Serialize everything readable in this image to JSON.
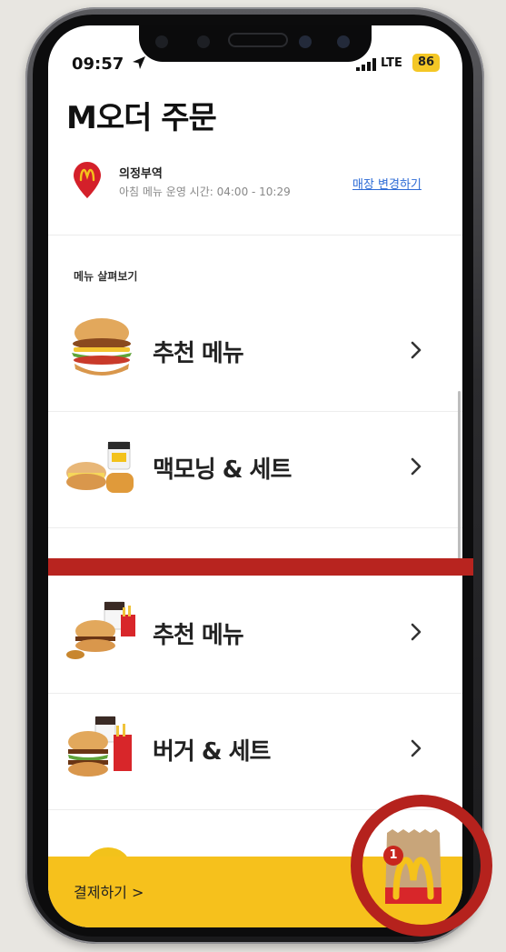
{
  "status_bar": {
    "time": "09:57",
    "network": "LTE",
    "battery": "86"
  },
  "header": {
    "title": "M오더 주문"
  },
  "store": {
    "name": "의정부역",
    "breakfast_hours": "아침 메뉴 운영 시간: 04:00 - 10:29",
    "change_link": "매장 변경하기"
  },
  "browse": {
    "label": "메뉴 살펴보기"
  },
  "menu_items": [
    {
      "label": "추천 메뉴",
      "icon": "burger-icon"
    },
    {
      "label": "맥모닝 & 세트",
      "icon": "breakfast-set-icon"
    },
    {
      "label": "추천 메뉴",
      "icon": "burger-combo-icon"
    },
    {
      "label": "버거 & 세트",
      "icon": "burger-set-icon"
    }
  ],
  "checkout": {
    "label": "결제하기 >"
  },
  "cart": {
    "count": "1"
  },
  "colors": {
    "brand_yellow": "#f6c11c",
    "brand_red": "#c7261e",
    "highlight_red": "#b5221d",
    "link_blue": "#2d6bd6"
  }
}
